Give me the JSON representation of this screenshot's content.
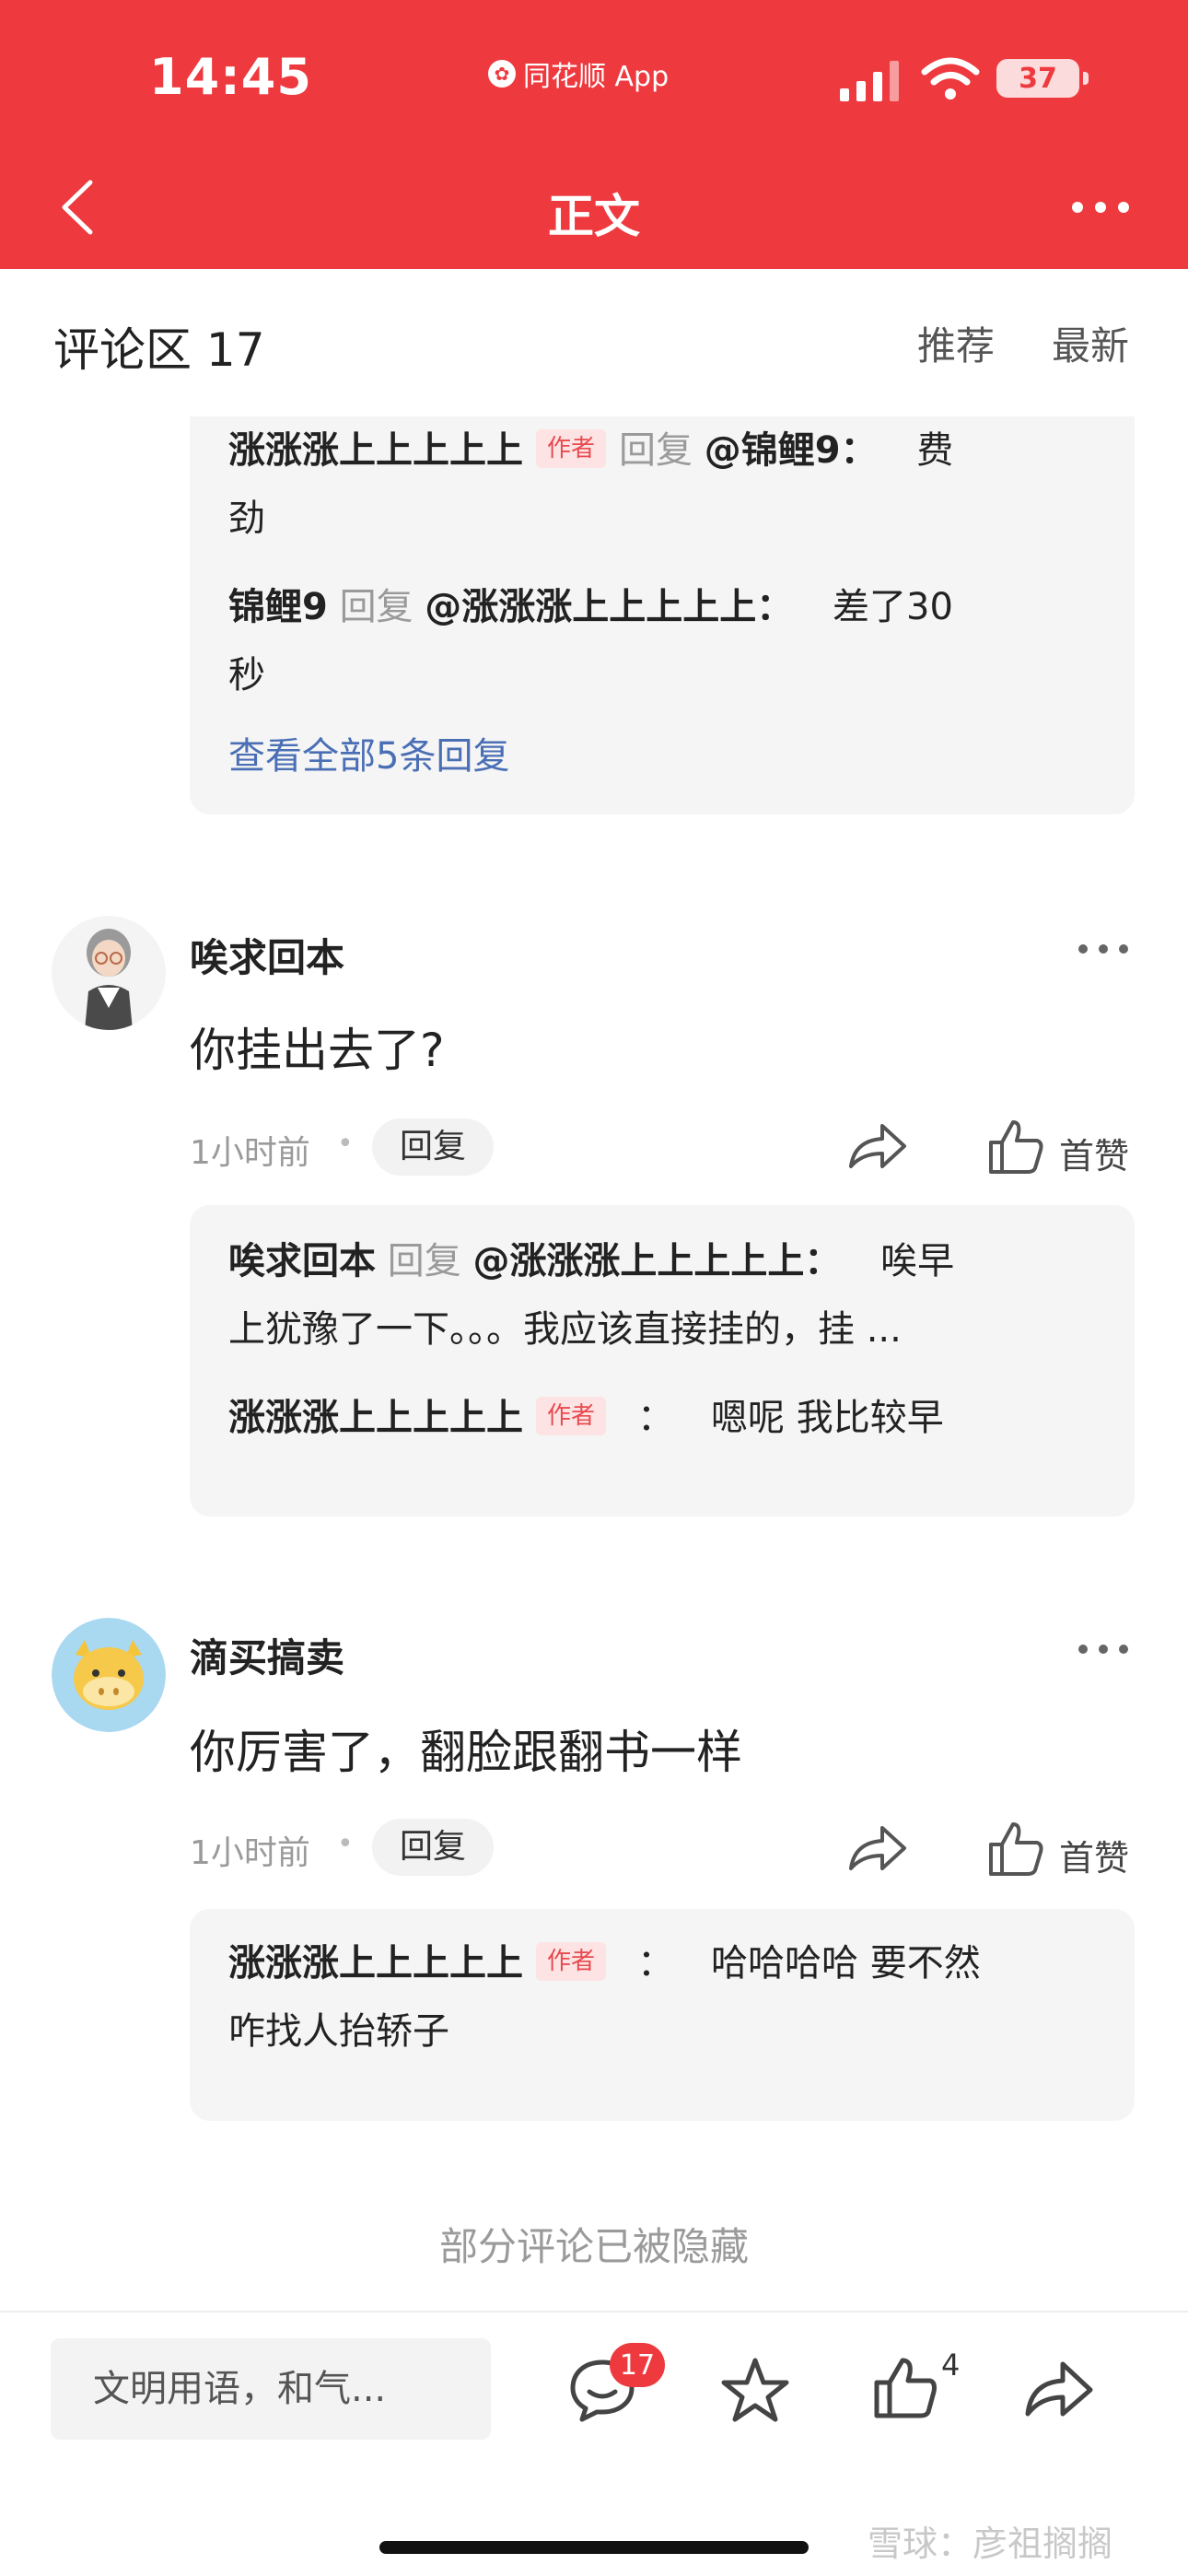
{
  "status_bar": {
    "time": "14:45",
    "app_label": "同花顺 App",
    "battery": "37"
  },
  "header": {
    "title": "正文"
  },
  "comments_header": {
    "title": "评论区 17",
    "sort_tabs": [
      "推荐",
      "最新"
    ]
  },
  "top_reply_box": {
    "replies": [
      {
        "name": "涨涨涨上上上上上",
        "badge": "作者",
        "reply_word": "回复",
        "target": "@锦鲤9：",
        "text": "费",
        "text_cont": "劲"
      },
      {
        "name": "锦鲤9",
        "reply_word": "回复",
        "target": "@涨涨涨上上上上上：",
        "text": "差了30",
        "text_cont": "秒"
      }
    ],
    "view_all": "查看全部5条回复"
  },
  "comments": [
    {
      "username": "唉求回本",
      "text": "你挂出去了?",
      "time": "1小时前",
      "reply_label": "回复",
      "like_label": "首赞",
      "replies": [
        {
          "name": "唉求回本",
          "reply_word": "回复",
          "target": "@涨涨涨上上上上上：",
          "text": "唉早",
          "text_cont": "上犹豫了一下。。。我应该直接挂的，挂 ..."
        },
        {
          "name": "涨涨涨上上上上上",
          "badge": "作者",
          "sep": "：",
          "text": "嗯呢 我比较早"
        }
      ]
    },
    {
      "username": "滴买搞卖",
      "text": "你厉害了，翻脸跟翻书一样",
      "time": "1小时前",
      "reply_label": "回复",
      "like_label": "首赞",
      "replies": [
        {
          "name": "涨涨涨上上上上上",
          "badge": "作者",
          "sep": "：",
          "text": "哈哈哈哈 要不然",
          "text_cont": "咋找人抬轿子"
        }
      ]
    }
  ],
  "hidden_note": "部分评论已被隐藏",
  "bottom_bar": {
    "input_placeholder": "文明用语，和气...",
    "comment_count": "17",
    "like_count": "4"
  },
  "watermark": "雪球：彦祖搁搁",
  "colors": {
    "brand_red": "#ee3a3f",
    "link_blue": "#4a6fb5",
    "author_badge_bg": "#fde3e3",
    "author_badge_text": "#e84a4f"
  },
  "icons": [
    "back-chevron-icon",
    "more-dots-icon",
    "share-arrow-icon",
    "thumbs-up-icon",
    "comment-bubble-icon",
    "star-icon",
    "signal-icon",
    "wifi-icon"
  ]
}
